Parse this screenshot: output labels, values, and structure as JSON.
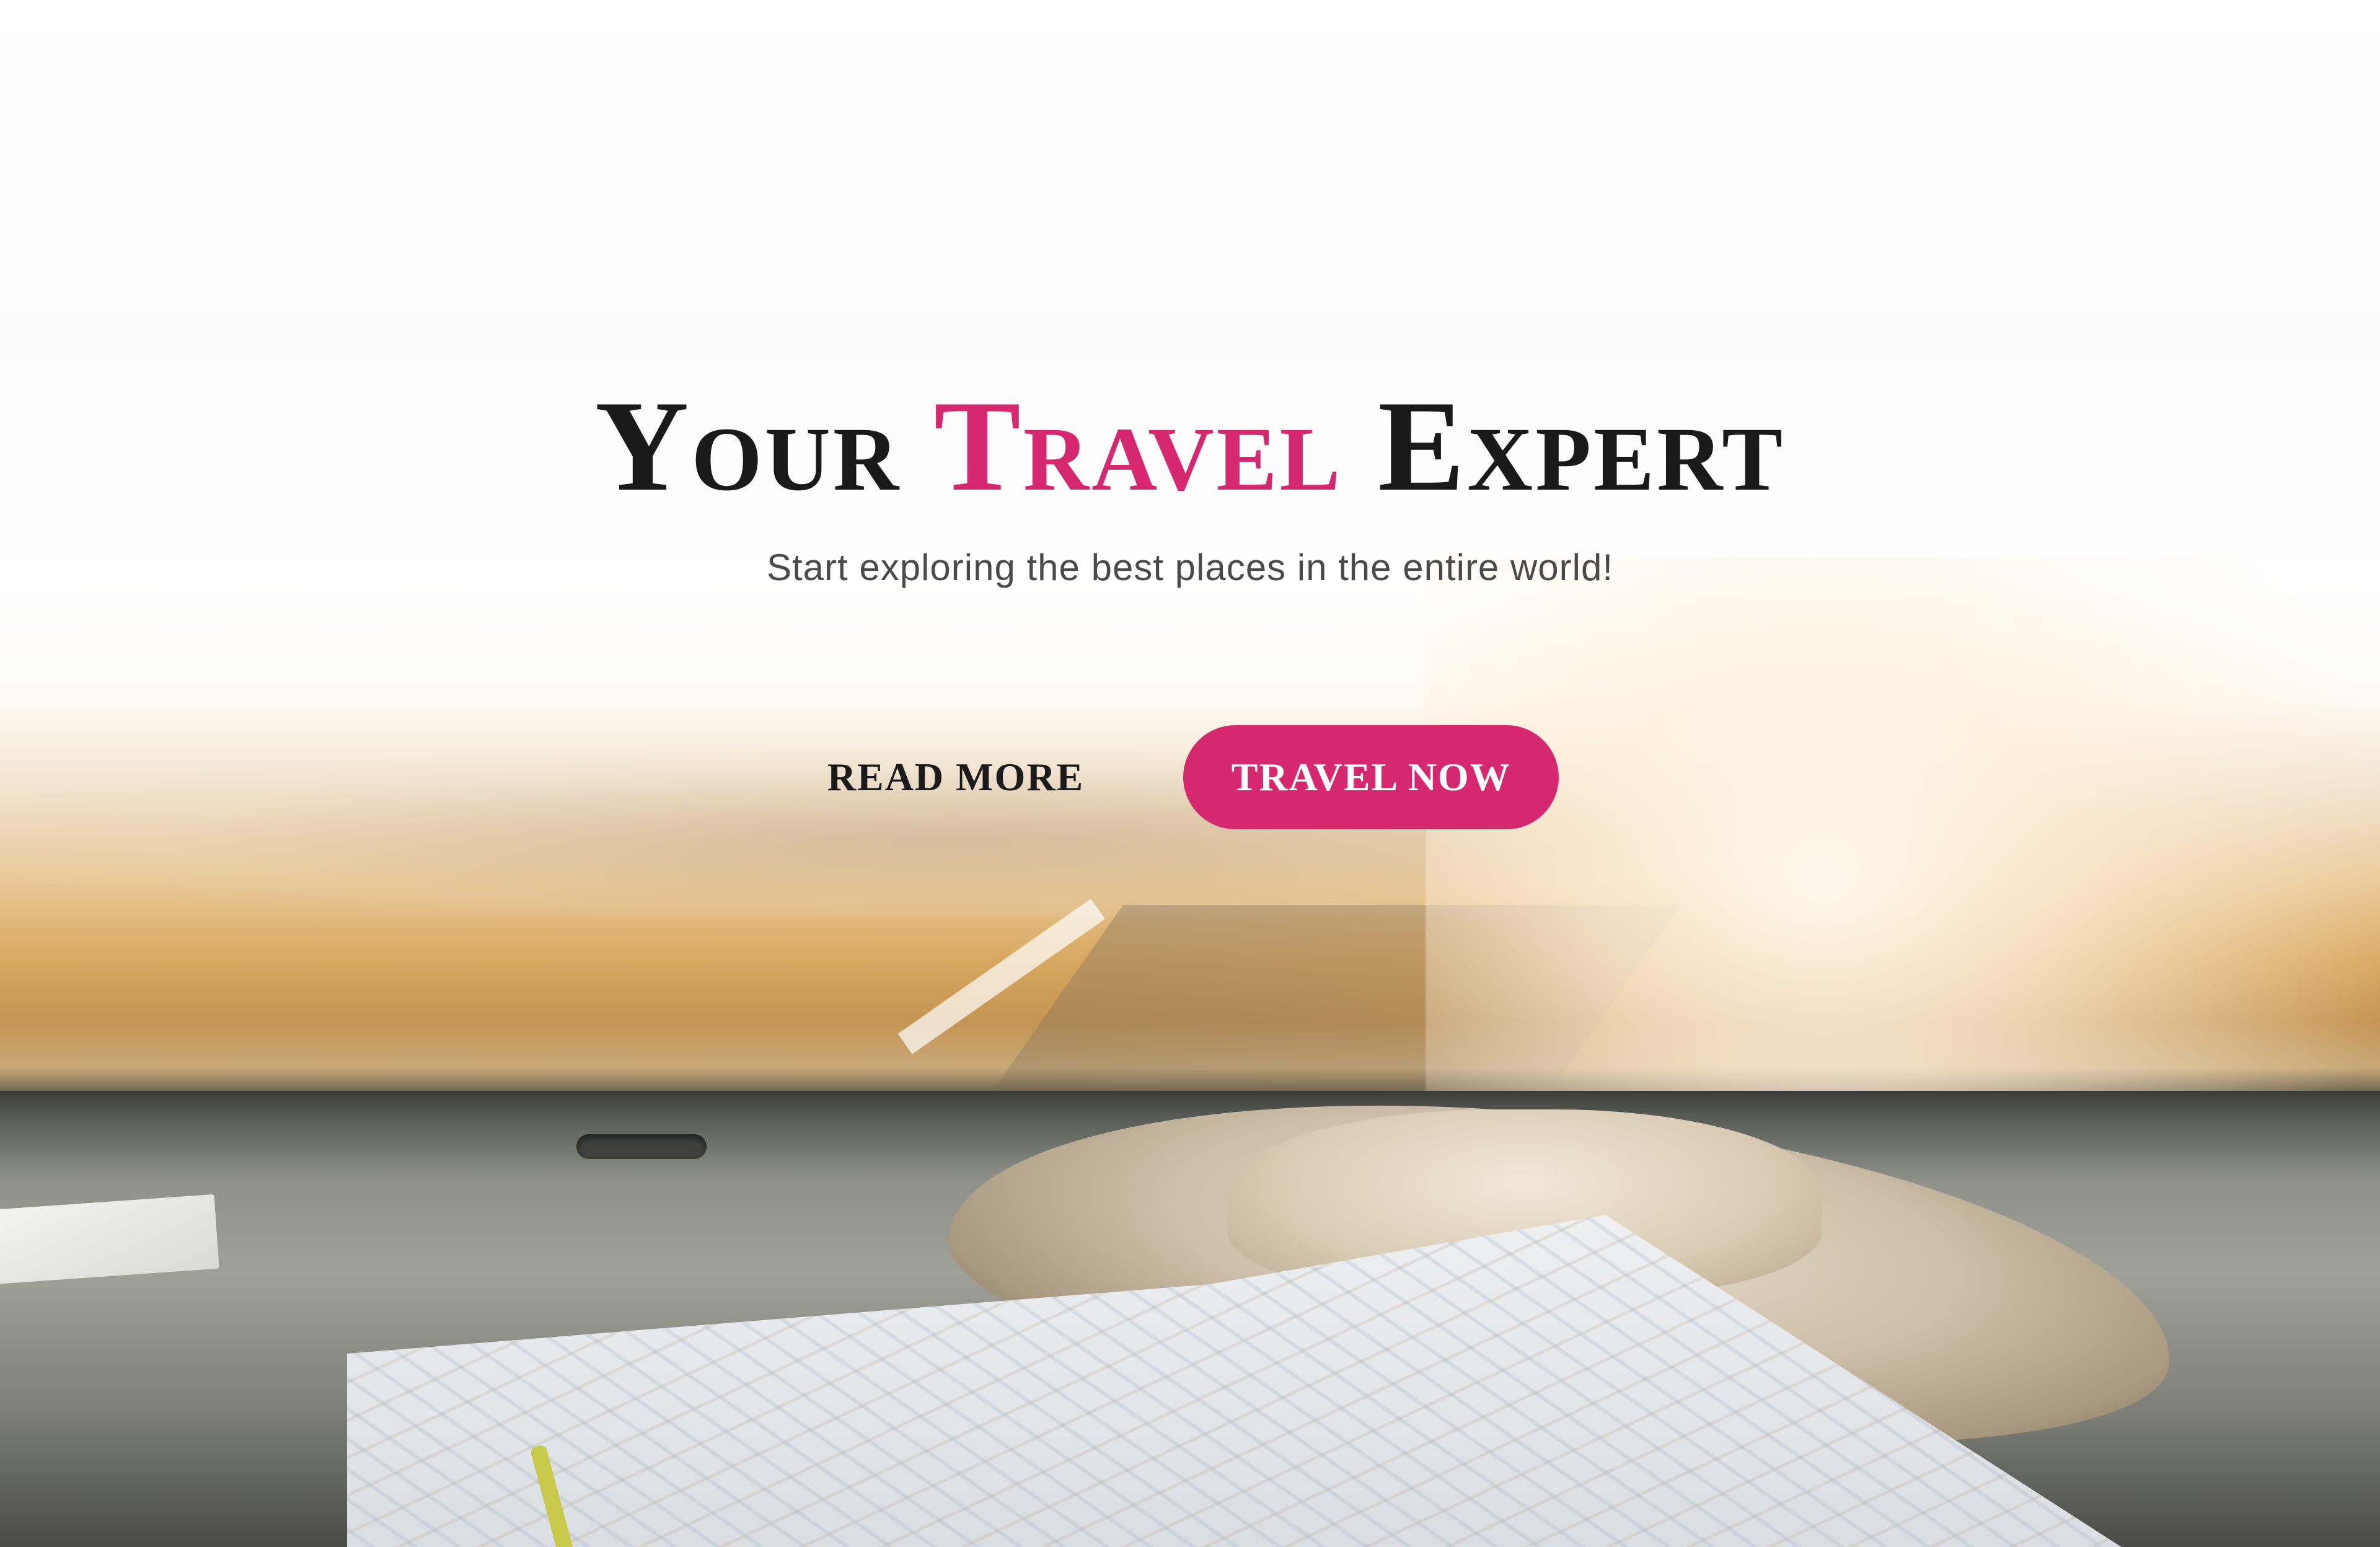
{
  "hero": {
    "title_part1": "Your",
    "title_part2": "Travel",
    "title_part3": "Expert",
    "subtitle": "Start exploring the best places in the entire world!",
    "read_more_label": "READ MORE",
    "travel_now_label": "TRAVEL NOW"
  },
  "colors": {
    "accent": "#d6286f",
    "heading": "#1a1a1a",
    "subtitle": "#4a4a4a",
    "button_text": "#ffffff"
  },
  "background": {
    "scene": "car-dashboard-with-hat-and-map-road-trip-photo"
  }
}
